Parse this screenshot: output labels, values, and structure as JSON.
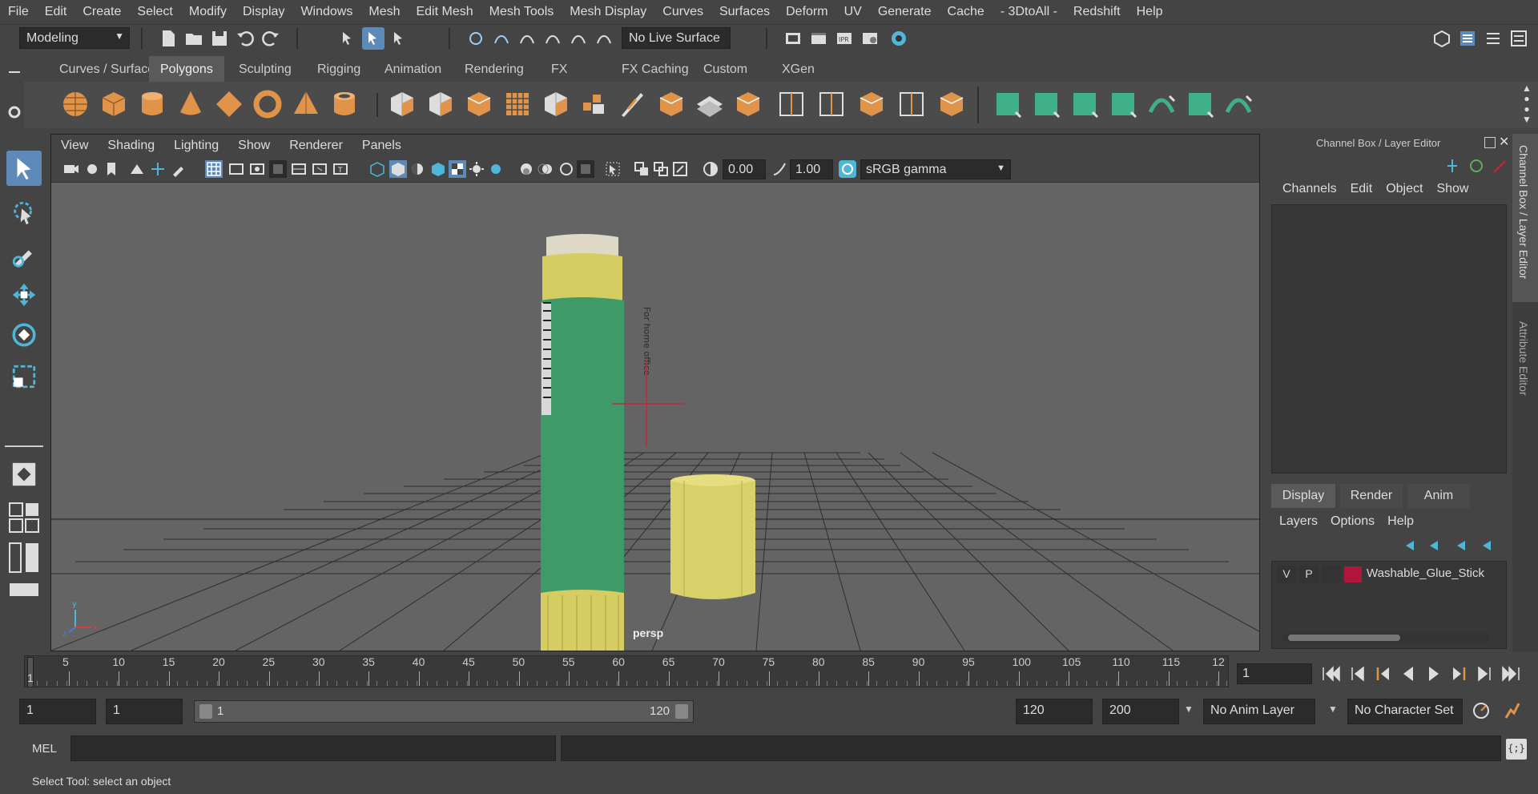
{
  "menu": [
    "File",
    "Edit",
    "Create",
    "Select",
    "Modify",
    "Display",
    "Windows",
    "Mesh",
    "Edit Mesh",
    "Mesh Tools",
    "Mesh Display",
    "Curves",
    "Surfaces",
    "Deform",
    "UV",
    "Generate",
    "Cache",
    "- 3DtoAll -",
    "Redshift",
    "Help"
  ],
  "status": {
    "mode": "Modeling",
    "live_surface": "No Live Surface"
  },
  "shelf_tabs": [
    "Curves / Surfaces",
    "Polygons",
    "Sculpting",
    "Rigging",
    "Animation",
    "Rendering",
    "FX",
    "FX Caching",
    "Custom",
    "XGen"
  ],
  "shelf_active": "Polygons",
  "viewport": {
    "menu": [
      "View",
      "Shading",
      "Lighting",
      "Show",
      "Renderer",
      "Panels"
    ],
    "exposure": "0.00",
    "gamma": "1.00",
    "color_space": "sRGB gamma",
    "camera": "persp",
    "label_text": "For home office"
  },
  "channel_box": {
    "title": "Channel Box / Layer Editor",
    "menu": [
      "Channels",
      "Edit",
      "Object",
      "Show"
    ]
  },
  "layer_editor": {
    "tabs": [
      "Display",
      "Render",
      "Anim"
    ],
    "menu": [
      "Layers",
      "Options",
      "Help"
    ],
    "layer": {
      "v": "V",
      "p": "P",
      "name": "Washable_Glue_Stick",
      "color": "#b0153a"
    }
  },
  "side_tabs": [
    "Channel Box / Layer Editor",
    "Attribute Editor"
  ],
  "timeline": {
    "ticks": [
      "5",
      "10",
      "15",
      "20",
      "25",
      "30",
      "35",
      "40",
      "45",
      "50",
      "55",
      "60",
      "65",
      "70",
      "75",
      "80",
      "85",
      "90",
      "95",
      "100",
      "105",
      "110",
      "115",
      "12"
    ],
    "start_marker": "1",
    "current_frame": "1"
  },
  "range": {
    "start": "1",
    "anim_start": "1",
    "slider_start": "1",
    "slider_end": "120",
    "end": "120",
    "anim_end": "200",
    "anim_layer": "No Anim Layer",
    "char_set": "No Character Set"
  },
  "cmd": {
    "label": "MEL"
  },
  "help": "Select Tool: select an object",
  "colors": {
    "accent": "#5d8ab8",
    "orange": "#e0944a",
    "green": "#3fb088",
    "glue_green": "#3f9a6a",
    "glue_yellow": "#d8d068"
  }
}
